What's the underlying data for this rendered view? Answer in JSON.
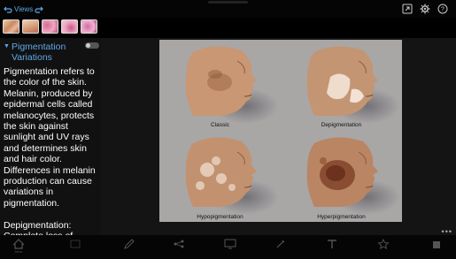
{
  "topbar": {
    "views_label": "Views",
    "icons": [
      "undo-arrow-icon",
      "redo-arrow-icon",
      "share-icon",
      "settings-gear-icon",
      "help-icon"
    ]
  },
  "thumbnails": [
    "thumbnail-1",
    "thumbnail-2",
    "thumbnail-3",
    "thumbnail-4",
    "thumbnail-5"
  ],
  "panel": {
    "title": "Pigmentation Variations",
    "paragraphs": [
      "Pigmentation refers to the color of the skin. Melanin, produced by epidermal cells called melanocytes, protects the skin against sunlight and UV rays and determines skin and hair color. Differences in melanin production can cause variations in pigmentation.",
      "Depigmentation: Complete loss of"
    ]
  },
  "figure": {
    "captions": [
      "Classic",
      "Depigmentation",
      "Hypopigmentation",
      "Hyperpigmentation"
    ]
  },
  "bottombar": {
    "tools": [
      "Menu",
      "",
      "",
      "",
      "",
      "",
      "",
      "",
      "",
      "",
      ""
    ]
  },
  "colors": {
    "accent": "#5da9e9",
    "background": "#000000",
    "panel": "#111111",
    "figure_background": "#a9a6a6"
  }
}
